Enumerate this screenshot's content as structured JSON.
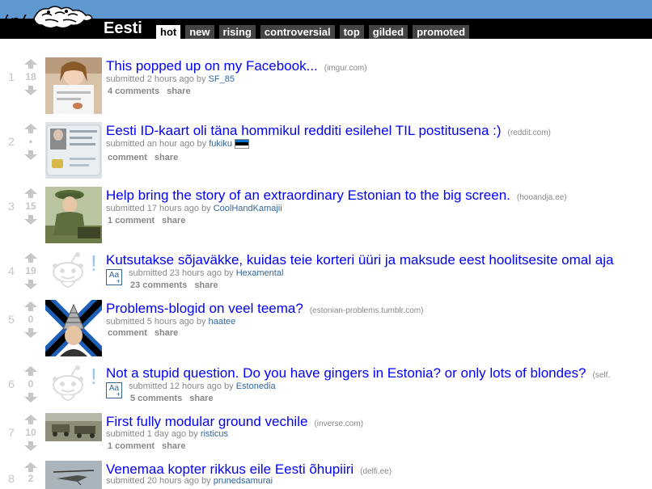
{
  "header": {
    "logo_text": "/r/",
    "subreddit": "Eesti",
    "tabs": [
      {
        "label": "hot",
        "active": true
      },
      {
        "label": "new",
        "active": false
      },
      {
        "label": "rising",
        "active": false
      },
      {
        "label": "controversial",
        "active": false
      },
      {
        "label": "top",
        "active": false
      },
      {
        "label": "gilded",
        "active": false
      },
      {
        "label": "promoted",
        "active": false
      }
    ]
  },
  "posts": [
    {
      "rank": "1",
      "score": "18",
      "title": "This popped up on my Facebook...",
      "domain": "(imgur.com)",
      "submitted": "submitted 2 hours ago by",
      "author": "SF_85",
      "comments": "4 comments",
      "share": "share"
    },
    {
      "rank": "2",
      "score": "•",
      "title": "Eesti ID-kaart oli täna hommikul redditi esilehel TIL postitusena :)",
      "domain": "(reddit.com)",
      "submitted": "submitted an hour ago by",
      "author": "fukiku",
      "comments": "comment",
      "share": "share"
    },
    {
      "rank": "3",
      "score": "15",
      "title": "Help bring the story of an extraordinary Estonian to the big screen.",
      "domain": "(hooandja.ee)",
      "submitted": "submitted 17 hours ago by",
      "author": "CoolHandKamajii",
      "comments": "1 comment",
      "share": "share"
    },
    {
      "rank": "4",
      "score": "19",
      "title": "Kutsutakse sõjaväkke, kuidas teie korteri üüri ja maksude eest hoolitsesite omal aja",
      "domain": "",
      "submitted": "submitted 23 hours ago by",
      "author": "Hexamental",
      "comments": "23 comments",
      "share": "share"
    },
    {
      "rank": "5",
      "score": "0",
      "title": "Problems-blogid on veel teema?",
      "domain": "(estonian-problems.tumblr.com)",
      "submitted": "submitted 5 hours ago by",
      "author": "haatee",
      "comments": "comment",
      "share": "share"
    },
    {
      "rank": "6",
      "score": "0",
      "title": "Not a stupid question. Do you have gingers in Estonia? or only lots of blondes?",
      "domain": "(self.",
      "submitted": "submitted 12 hours ago by",
      "author": "Estonedia",
      "comments": "5 comments",
      "share": "share"
    },
    {
      "rank": "7",
      "score": "10",
      "title": "First fully modular ground vechile",
      "domain": "(inverse.com)",
      "submitted": "submitted 1 day ago by",
      "author": "risticus",
      "comments": "1 comment",
      "share": "share"
    },
    {
      "rank": "8",
      "score": "2",
      "title": "Venemaa kopter rikkus eile Eesti õhupiiri",
      "domain": "(delfi.ee)",
      "submitted": "submitted 20 hours ago by",
      "author": "prunedsamurai",
      "comments": "",
      "share": ""
    }
  ],
  "text_post_icon": {
    "label": "Aa",
    "plus": "+"
  },
  "colors": {
    "header_blue": "#5f99cf",
    "link": "#0000ff",
    "author": "#336699",
    "muted": "#888888"
  }
}
